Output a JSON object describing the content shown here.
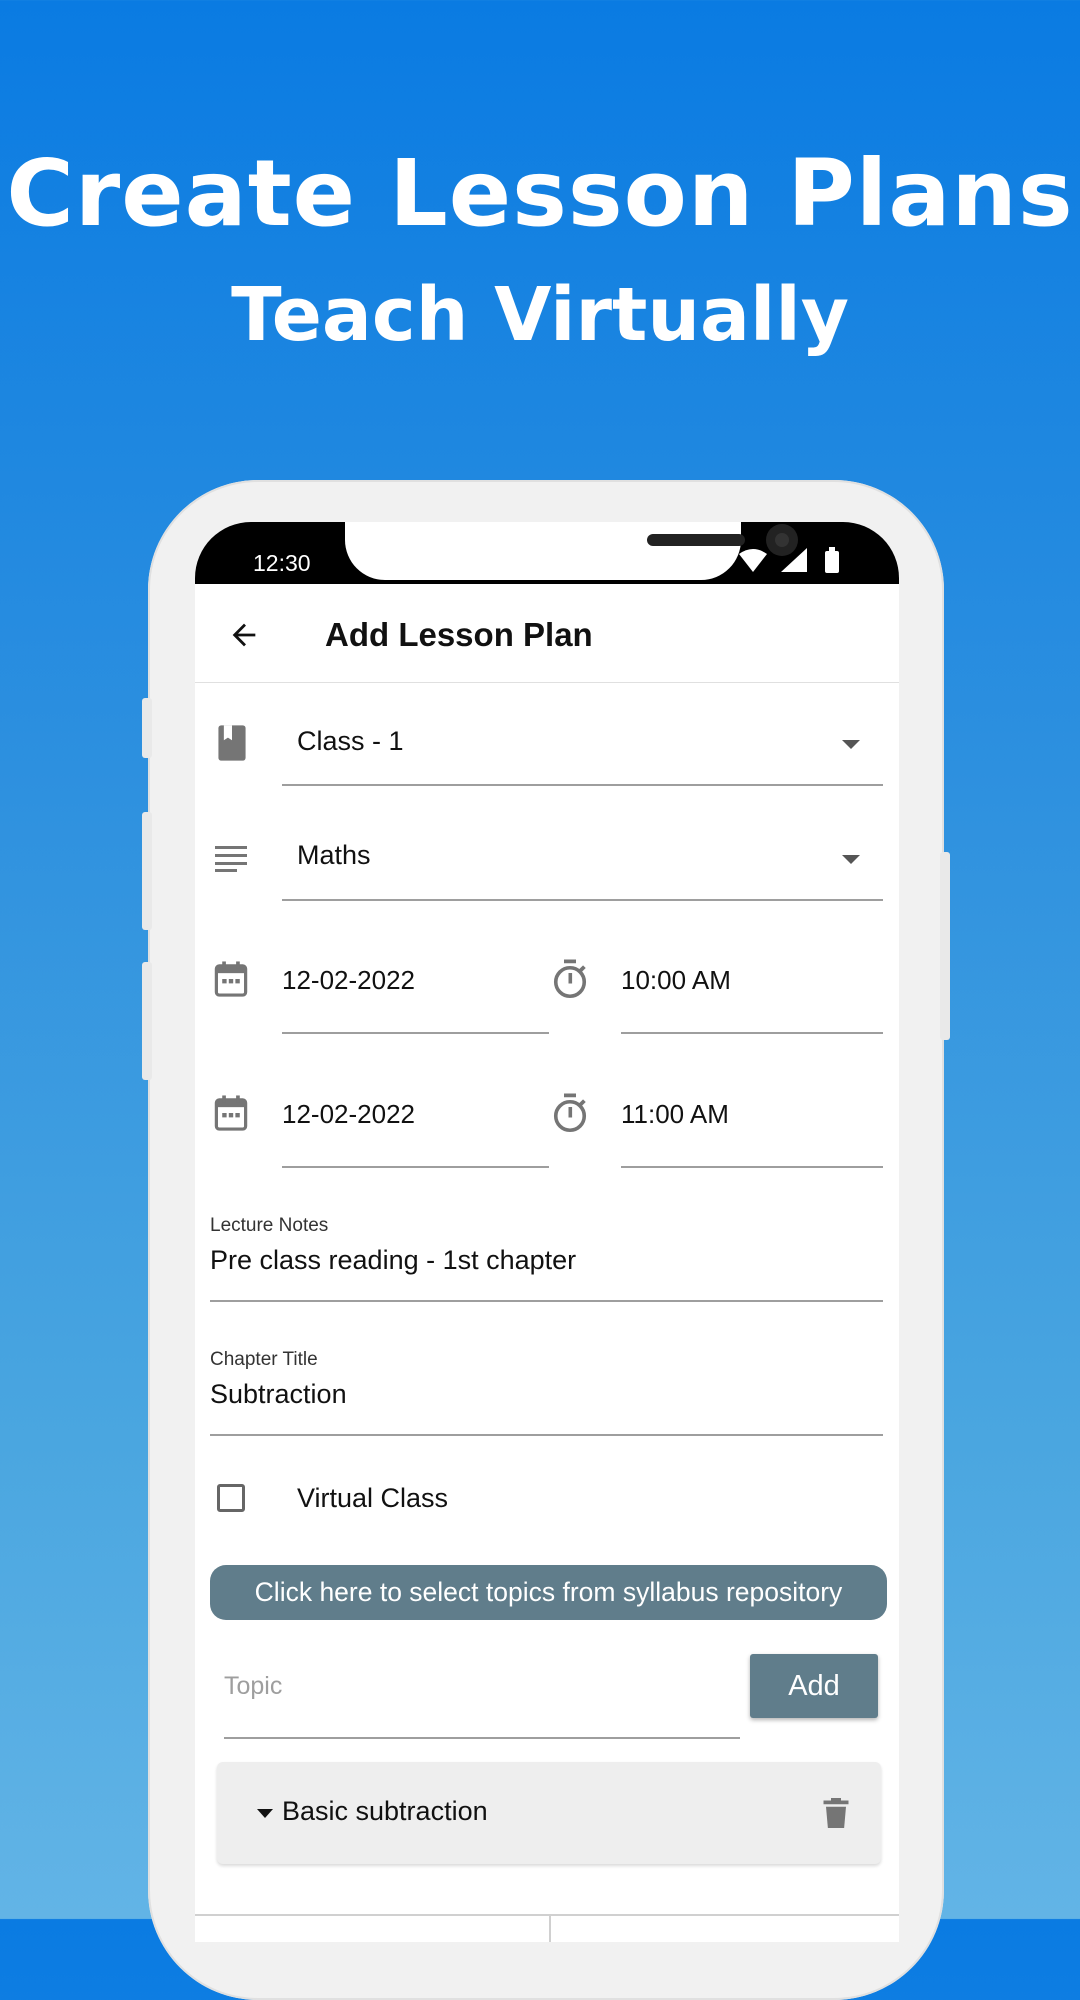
{
  "hero": {
    "headline": "Create Lesson Plans",
    "subheadline": "Teach Virtually"
  },
  "status_bar": {
    "time": "12:30",
    "icons": [
      "wifi-icon",
      "signal-icon",
      "battery-icon"
    ]
  },
  "app_bar": {
    "back_icon": "arrow-left-icon",
    "title": "Add Lesson Plan"
  },
  "form": {
    "class_select": {
      "icon": "book-icon",
      "value": "Class - 1"
    },
    "subject_select": {
      "icon": "list-lines-icon",
      "value": "Maths"
    },
    "start": {
      "date_icon": "calendar-icon",
      "date": "12-02-2022",
      "time_icon": "timer-icon",
      "time": "10:00 AM"
    },
    "end": {
      "date_icon": "calendar-icon",
      "date": "12-02-2022",
      "time_icon": "timer-icon",
      "time": "11:00 AM"
    },
    "lecture_notes": {
      "label": "Lecture Notes",
      "value": "Pre class reading - 1st chapter"
    },
    "chapter_title": {
      "label": "Chapter Title",
      "value": "Subtraction"
    },
    "virtual_class": {
      "label": "Virtual Class",
      "checked": false
    },
    "syllabus_button": "Click here to select topics from syllabus repository",
    "topic_input": {
      "placeholder": "Topic",
      "value": ""
    },
    "add_button": "Add",
    "topics": [
      {
        "label": "Basic subtraction",
        "icon": "trash-icon"
      }
    ]
  },
  "colors": {
    "background_top": "#0a7be2",
    "background_bottom": "#62b4e6",
    "button_slate": "#607d8b",
    "card_gray": "#eeeeee"
  }
}
